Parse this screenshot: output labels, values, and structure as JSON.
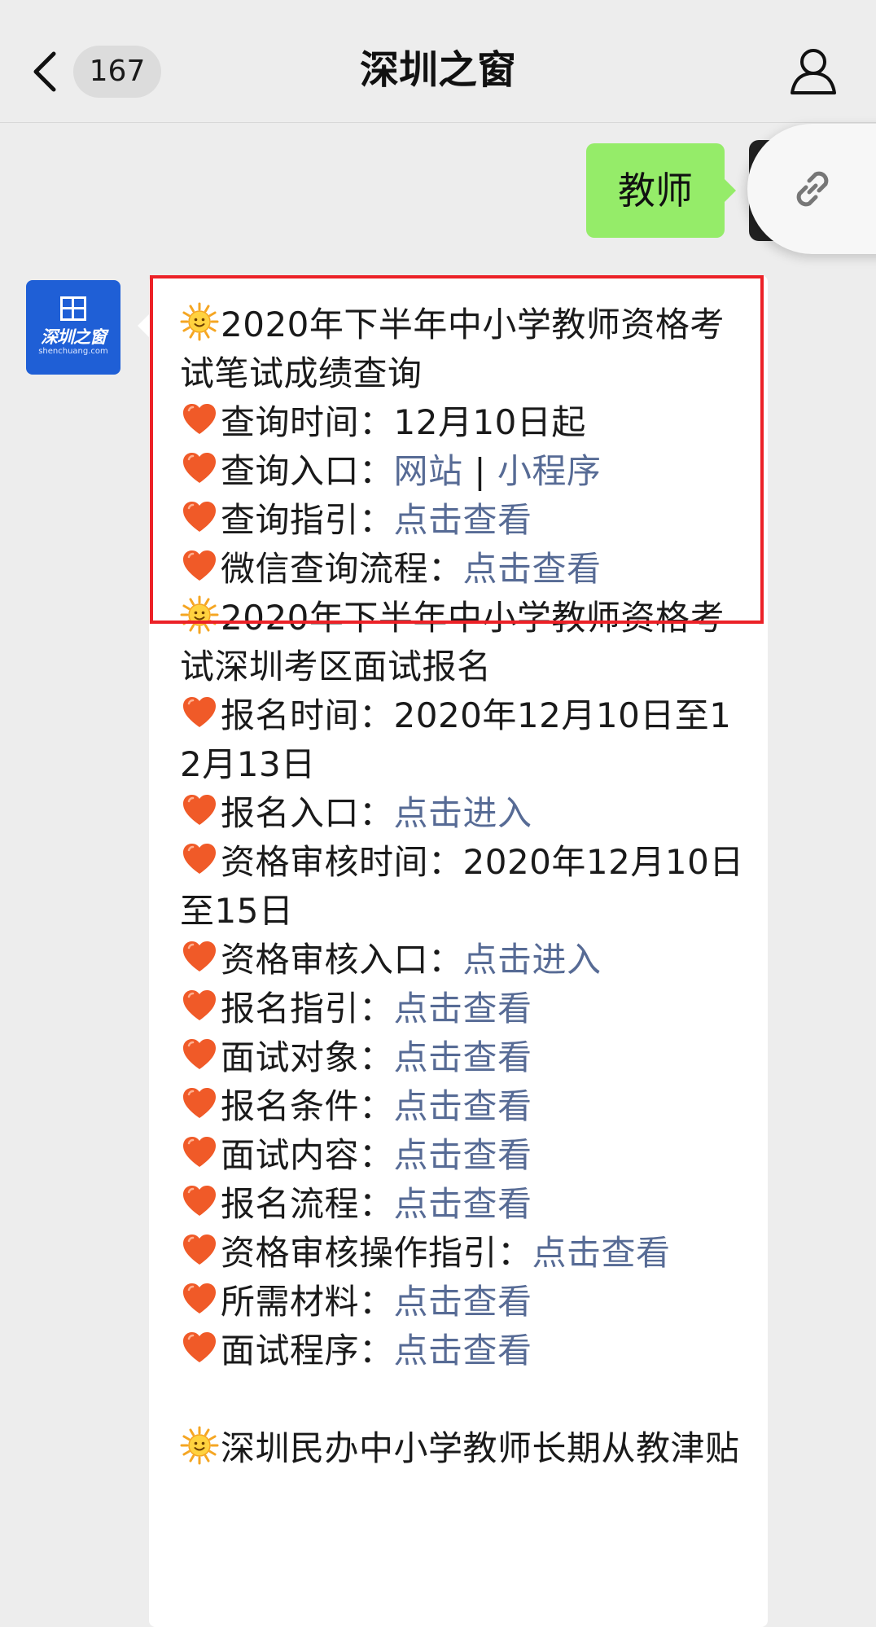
{
  "header": {
    "title": "深圳之窗",
    "unread_count": "167"
  },
  "chat": {
    "outgoing_message": "教师",
    "incoming_avatar": {
      "brand": "深圳之窗",
      "brand_sub": "shenchuang.com"
    },
    "sections": [
      {
        "title": "2020年下半年中小学教师资格考试笔试成绩查询",
        "items": [
          {
            "label": "查询时间：",
            "value": "12月10日起"
          },
          {
            "label": "查询入口：",
            "links": [
              "网站",
              "小程序"
            ],
            "separator": "|"
          },
          {
            "label": "查询指引：",
            "links": [
              "点击查看"
            ]
          },
          {
            "label": "微信查询流程：",
            "links": [
              "点击查看"
            ]
          }
        ]
      },
      {
        "title": "2020年下半年中小学教师资格考试深圳考区面试报名",
        "items": [
          {
            "label": "报名时间：",
            "value": "2020年12月10日至12月13日"
          },
          {
            "label": "报名入口：",
            "links": [
              "点击进入"
            ]
          },
          {
            "label": "资格审核时间：",
            "value": "2020年12月10日至15日"
          },
          {
            "label": "资格审核入口：",
            "links": [
              "点击进入"
            ]
          },
          {
            "label": "报名指引：",
            "links": [
              "点击查看"
            ]
          },
          {
            "label": "面试对象：",
            "links": [
              "点击查看"
            ]
          },
          {
            "label": "报名条件：",
            "links": [
              "点击查看"
            ]
          },
          {
            "label": "面试内容：",
            "links": [
              "点击查看"
            ]
          },
          {
            "label": "报名流程：",
            "links": [
              "点击查看"
            ]
          },
          {
            "label": "资格审核操作指引：",
            "links": [
              "点击查看"
            ]
          },
          {
            "label": "所需材料：",
            "links": [
              "点击查看"
            ]
          },
          {
            "label": "面试程序：",
            "links": [
              "点击查看"
            ]
          }
        ]
      },
      {
        "title": "深圳民办中小学教师长期从教津贴"
      }
    ]
  },
  "colors": {
    "background": "#ededed",
    "outgoing_bubble": "#95ec69",
    "link": "#576b95",
    "highlight_border": "#ec2127",
    "avatar_blue": "#1f5fd6"
  },
  "icons": {
    "back": "chevron-left-icon",
    "profile": "person-icon",
    "link": "link-icon",
    "sun": "sun-emoji-icon",
    "heart": "heart-emoji-icon"
  }
}
